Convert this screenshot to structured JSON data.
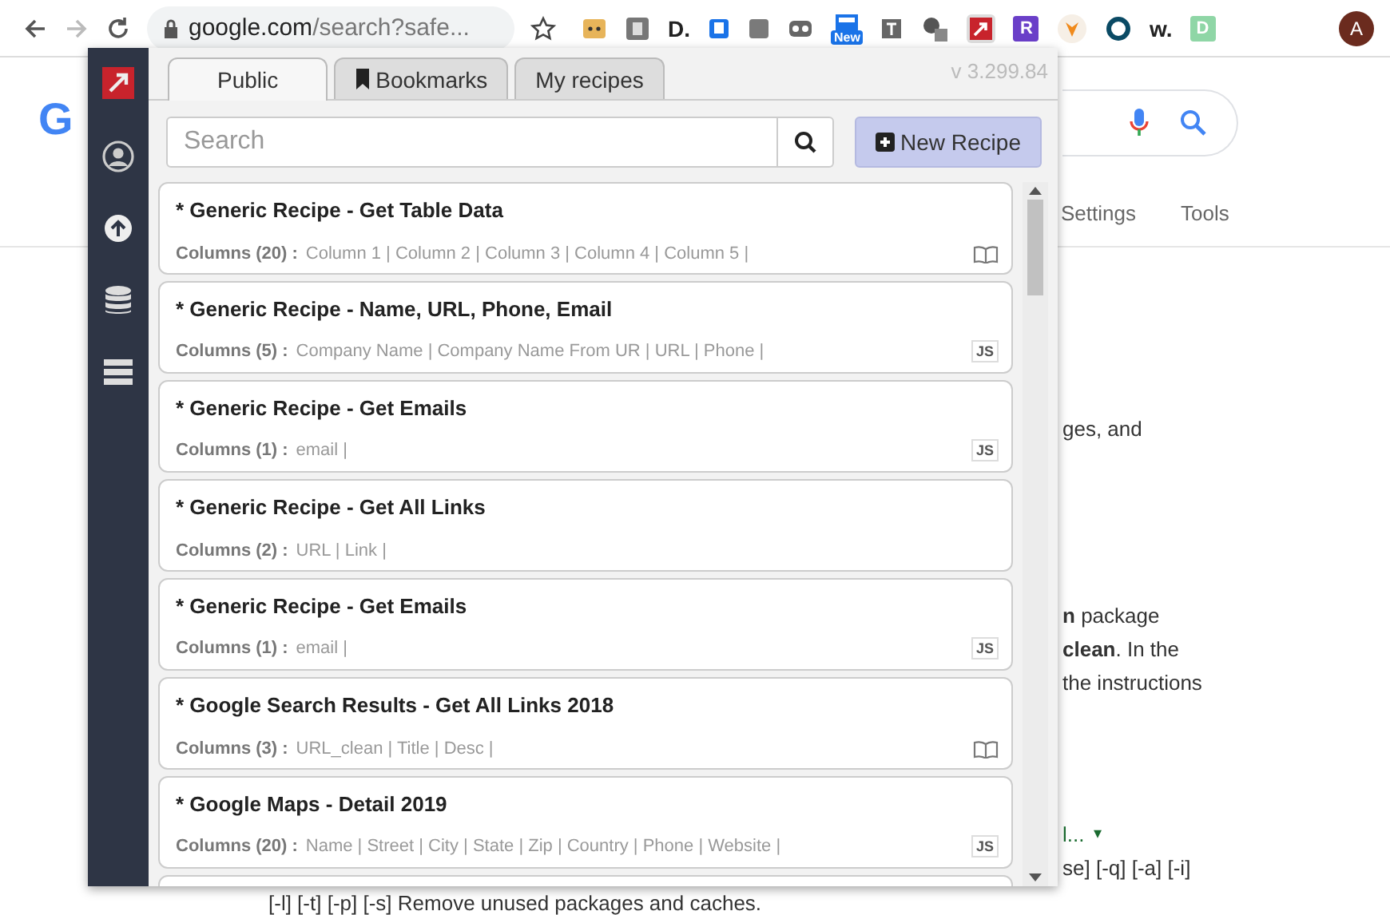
{
  "browser": {
    "url_host": "google.com",
    "url_rest": "/search?safe...",
    "extensions": [
      {
        "kind": "box"
      },
      {
        "kind": "letter",
        "text": "D."
      },
      {
        "kind": "new",
        "text": "New"
      },
      {
        "kind": "letter-box",
        "text": "R",
        "color": "#6a3fc8"
      },
      {
        "kind": "letter",
        "text": "w."
      },
      {
        "kind": "letter-box",
        "text": "D",
        "color": "#8fd6a6"
      }
    ],
    "avatar": "A"
  },
  "google_page": {
    "logo": "G",
    "toolbar": [
      "Settings",
      "Tools"
    ],
    "snippets": [
      {
        "kind": "plain",
        "text": "ges, and"
      },
      {
        "kind": "rich",
        "text": "**n** package"
      },
      {
        "kind": "rich",
        "text": "**clean**. In the"
      },
      {
        "kind": "plain",
        "text": "the instructions"
      },
      {
        "kind": "link",
        "text": "l...",
        "caret": "▾"
      },
      {
        "kind": "plain",
        "text": "se] [-q] [-a] [-i]"
      }
    ],
    "footer_line": "[-l] [-t] [-p] [-s] Remove unused packages and caches."
  },
  "popup": {
    "tabs": [
      {
        "label": "Public",
        "selected": true,
        "icon": false
      },
      {
        "label": "Bookmarks",
        "selected": false,
        "icon": true
      },
      {
        "label": "My recipes",
        "selected": false,
        "icon": false
      }
    ],
    "version": "v 3.299.84",
    "search": {
      "placeholder": "Search"
    },
    "new_button": "New Recipe",
    "recipes": [
      {
        "title": "* Generic Recipe - Get Table Data",
        "columns_label": "Columns (20) :",
        "columns": "Column 1 | Column 2 | Column 3 | Column 4 | Column 5 |",
        "kind": "book"
      },
      {
        "title": "* Generic Recipe - Name, URL, Phone, Email",
        "columns_label": "Columns (5) :",
        "columns": "Company Name | Company Name From UR | URL | Phone |",
        "kind": "js",
        "badge": "JS"
      },
      {
        "title": "* Generic Recipe - Get Emails",
        "columns_label": "Columns (1) :",
        "columns": "email |",
        "kind": "js",
        "badge": "JS"
      },
      {
        "title": "* Generic Recipe - Get All Links",
        "columns_label": "Columns (2) :",
        "columns": "URL | Link |",
        "kind": "none"
      },
      {
        "title": "* Generic Recipe - Get Emails",
        "columns_label": "Columns (1) :",
        "columns": "email |",
        "kind": "js",
        "badge": "JS"
      },
      {
        "title": "* Google Search Results - Get All Links 2018",
        "columns_label": "Columns (3) :",
        "columns": "URL_clean | Title | Desc |",
        "kind": "book"
      },
      {
        "title": "* Google Maps - Detail 2019",
        "columns_label": "Columns (20) :",
        "columns": "Name | Street | City | State | Zip | Country | Phone | Website |",
        "kind": "js",
        "badge": "JS"
      }
    ]
  }
}
